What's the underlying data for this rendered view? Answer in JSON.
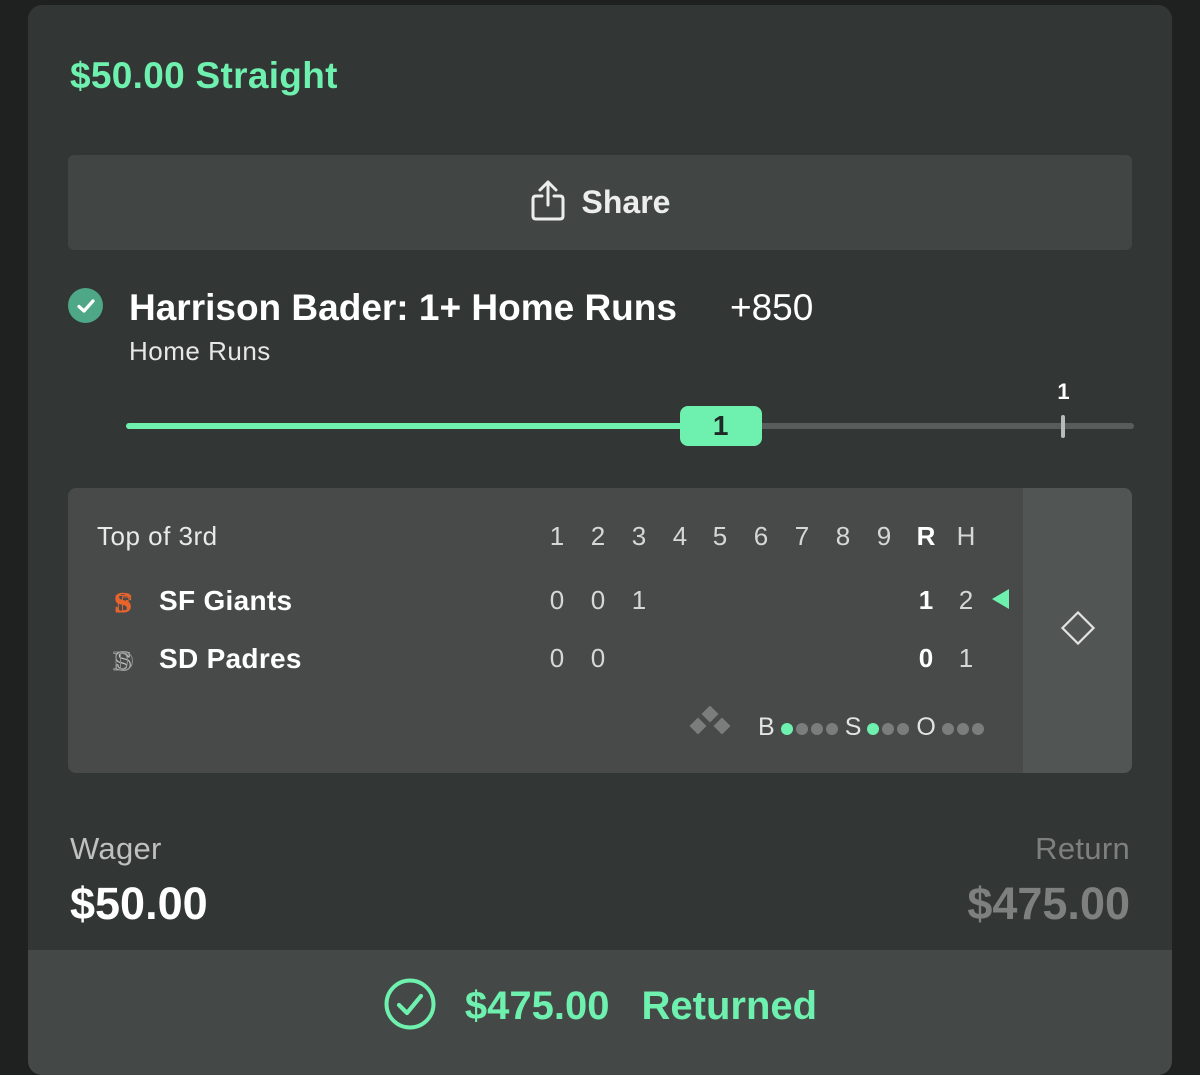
{
  "bet": {
    "title": "$50.00 Straight",
    "share_label": "Share"
  },
  "selection": {
    "title": "Harrison Bader: 1+ Home Runs",
    "odds": "+850",
    "market": "Home Runs",
    "status": "won"
  },
  "progress": {
    "current": "1",
    "target": "1",
    "fill_fraction": 0.59,
    "target_fraction": 0.93
  },
  "scoreboard": {
    "inning": "Top of 3rd",
    "headers": [
      "1",
      "2",
      "3",
      "4",
      "5",
      "6",
      "7",
      "8",
      "9",
      "R",
      "H"
    ],
    "teams": [
      {
        "name": "SF Giants",
        "logo": "sf-giants-logo",
        "innings": [
          "0",
          "0",
          "1"
        ],
        "runs": "1",
        "hits": "2",
        "batting": true
      },
      {
        "name": "SD Padres",
        "logo": "sd-padres-logo",
        "innings": [
          "0",
          "0"
        ],
        "runs": "0",
        "hits": "1",
        "batting": false
      }
    ],
    "count": {
      "balls_label": "B",
      "balls": 1,
      "balls_max": 4,
      "strikes_label": "S",
      "strikes": 1,
      "strikes_max": 3,
      "outs_label": "O",
      "outs": 0,
      "outs_max": 3
    }
  },
  "wager": {
    "label": "Wager",
    "value": "$50.00"
  },
  "return": {
    "label": "Return",
    "value": "$475.00"
  },
  "footer": {
    "amount": "$475.00",
    "text": "Returned"
  },
  "colors": {
    "accent": "#6ef0ae",
    "card": "#323634",
    "check": "#4ea887"
  }
}
